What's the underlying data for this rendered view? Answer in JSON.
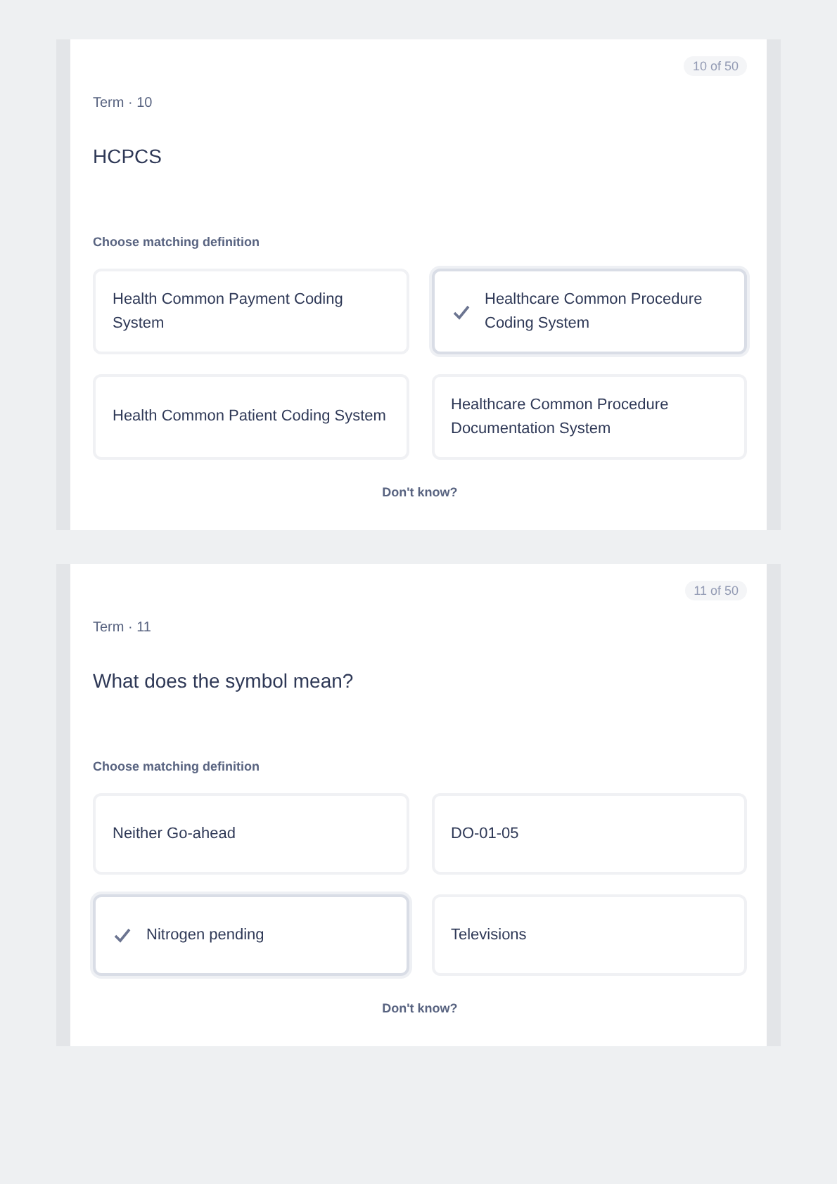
{
  "cards": [
    {
      "counter": "10 of 50",
      "term_label": "Term · 10",
      "term": "HCPCS",
      "prompt": "Choose matching definition",
      "options": [
        {
          "text": "Health Common Payment Coding System",
          "selected": false
        },
        {
          "text": "Healthcare Common Procedure Coding System",
          "selected": true
        },
        {
          "text": "Health Common Patient Coding System",
          "selected": false
        },
        {
          "text": "Healthcare Common Procedure Documentation System",
          "selected": false
        }
      ],
      "dont_know": "Don't know?"
    },
    {
      "counter": "11 of 50",
      "term_label": "Term · 11",
      "term": "What does the symbol mean?",
      "prompt": "Choose matching definition",
      "options": [
        {
          "text": "Neither Go-ahead",
          "selected": false
        },
        {
          "text": "DO-01-05",
          "selected": false
        },
        {
          "text": "Nitrogen pending",
          "selected": true
        },
        {
          "text": "Televisions",
          "selected": false
        }
      ],
      "dont_know": "Don't know?"
    }
  ]
}
